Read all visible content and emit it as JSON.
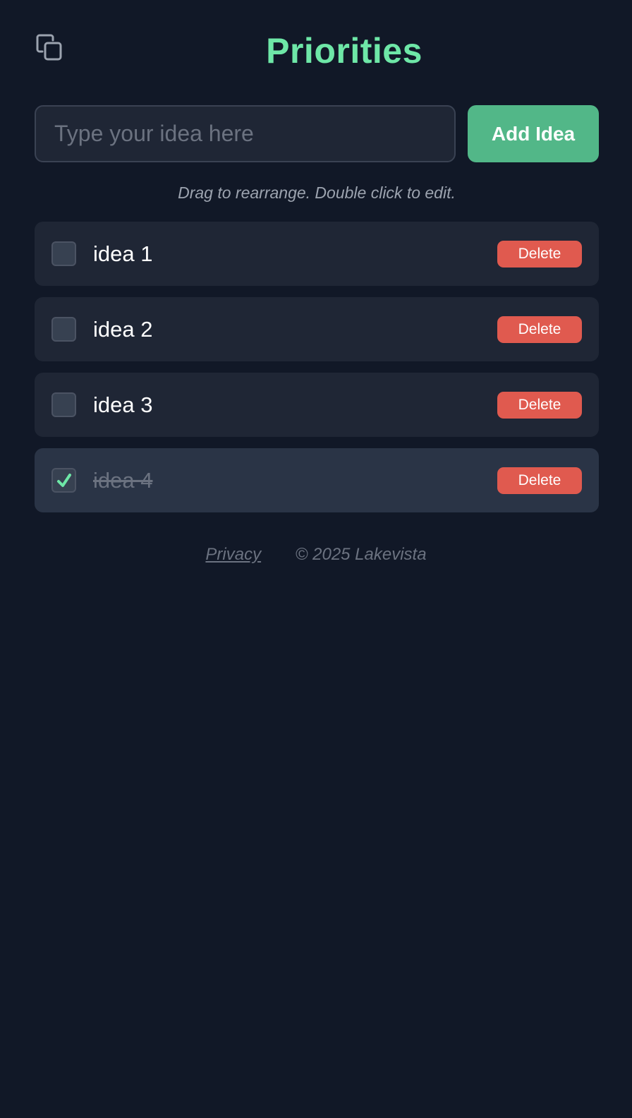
{
  "header": {
    "title": "Priorities",
    "copy_icon": "copy-icon"
  },
  "input": {
    "placeholder": "Type your idea here",
    "value": "",
    "add_label": "Add Idea"
  },
  "hint": "Drag to rearrange. Double click to edit.",
  "ideas": [
    {
      "text": "idea 1",
      "done": false,
      "delete_label": "Delete"
    },
    {
      "text": "idea 2",
      "done": false,
      "delete_label": "Delete"
    },
    {
      "text": "idea 3",
      "done": false,
      "delete_label": "Delete"
    },
    {
      "text": "idea 4",
      "done": true,
      "delete_label": "Delete"
    }
  ],
  "footer": {
    "privacy_label": "Privacy",
    "copyright": "© 2025 Lakevista"
  },
  "colors": {
    "background": "#111827",
    "accent": "#6ee7a7",
    "add_button": "#52b788",
    "delete_button": "#e05a4f",
    "card": "#1f2635",
    "card_done": "#2a3446"
  }
}
